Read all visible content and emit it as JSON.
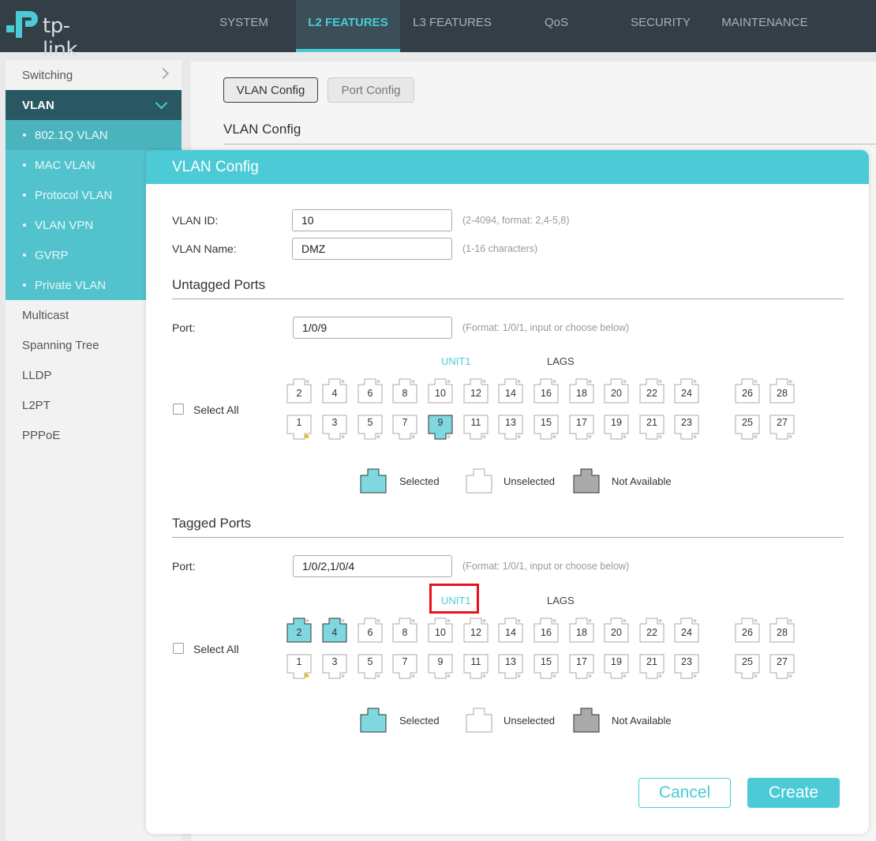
{
  "brand": {
    "logo_text": "tp-link"
  },
  "nav": [
    "SYSTEM",
    "L2 FEATURES",
    "L3 FEATURES",
    "QoS",
    "SECURITY",
    "MAINTENANCE"
  ],
  "sidebar": {
    "switching": "Switching",
    "vlan": "VLAN",
    "vlan_sub": [
      "802.1Q VLAN",
      "MAC VLAN",
      "Protocol VLAN",
      "VLAN VPN",
      "GVRP",
      "Private VLAN"
    ],
    "others": [
      "Multicast",
      "Spanning Tree",
      "LLDP",
      "L2PT",
      "PPPoE"
    ]
  },
  "main": {
    "tab_vlan_config": "VLAN Config",
    "tab_port_config": "Port Config",
    "section_title": "VLAN Config"
  },
  "modal": {
    "title": "VLAN Config",
    "vlan_id_label": "VLAN ID:",
    "vlan_id_value": "10",
    "vlan_id_hint": "(2-4094, format: 2,4-5,8)",
    "vlan_name_label": "VLAN Name:",
    "vlan_name_value": "DMZ",
    "vlan_name_hint": "(1-16 characters)",
    "untagged": {
      "title": "Untagged Ports",
      "port_label": "Port:",
      "port_value": "1/0/9",
      "port_hint": "(Format: 1/0/1, input or choose below)",
      "unit_label": "UNIT1",
      "lags_label": "LAGS",
      "select_all": "Select All",
      "selected_ports": [
        "9"
      ]
    },
    "tagged": {
      "title": "Tagged Ports",
      "port_label": "Port:",
      "port_value": "1/0/2,1/0/4",
      "port_hint": "(Format: 1/0/1, input or choose below)",
      "unit_label": "UNIT1",
      "lags_label": "LAGS",
      "select_all": "Select All",
      "selected_ports": [
        "2",
        "4"
      ]
    },
    "legend": {
      "selected": "Selected",
      "unselected": "Unselected",
      "not_available": "Not Available"
    },
    "buttons": {
      "cancel": "Cancel",
      "create": "Create"
    }
  },
  "ports": {
    "top_row": [
      "2",
      "4",
      "6",
      "8",
      "10",
      "12",
      "14",
      "16",
      "18",
      "20",
      "22",
      "24",
      "26",
      "28"
    ],
    "bottom_row": [
      "1",
      "3",
      "5",
      "7",
      "9",
      "11",
      "13",
      "15",
      "17",
      "19",
      "21",
      "23",
      "25",
      "27"
    ],
    "link_up_port": "1"
  },
  "colors": {
    "accent": "#4ccbd7",
    "selected_fill": "#7fd8df",
    "not_available_fill": "#aaaaaa",
    "led": "#f2c200",
    "highlight": "#e8121e"
  }
}
